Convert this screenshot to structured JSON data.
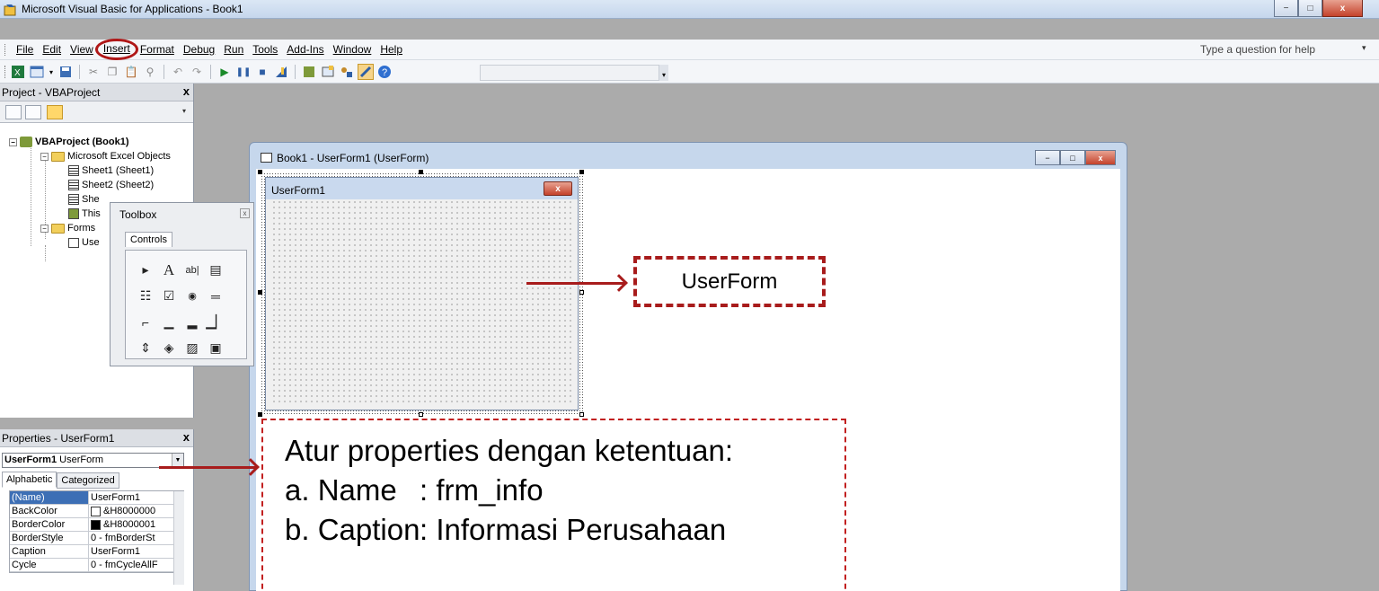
{
  "window": {
    "title": "Microsoft Visual Basic for Applications - Book1",
    "min_glyph": "−",
    "max_glyph": "□",
    "close_glyph": "x"
  },
  "menu": {
    "items": [
      "File",
      "Edit",
      "View",
      "Insert",
      "Format",
      "Debug",
      "Run",
      "Tools",
      "Add-Ins",
      "Window",
      "Help"
    ],
    "highlighted": "Insert",
    "help_placeholder": "Type a question for help"
  },
  "toolbar": {
    "icons": [
      "excel-icon",
      "insert-userform-icon",
      "dropdown-icon",
      "save-icon",
      "cut-icon",
      "copy-icon",
      "paste-icon",
      "find-icon",
      "undo-icon",
      "redo-icon",
      "run-icon",
      "break-icon",
      "reset-icon",
      "design-mode-icon",
      "project-explorer-icon",
      "properties-icon",
      "object-browser-icon",
      "toolbox-icon",
      "help-icon"
    ]
  },
  "project": {
    "title": "Project - VBAProject",
    "close": "x",
    "tree": {
      "root": "VBAProject (Book1)",
      "excel_folder": "Microsoft Excel Objects",
      "sheet1": "Sheet1 (Sheet1)",
      "sheet2": "Sheet2 (Sheet2)",
      "sheet3": "She",
      "thisworkbook": "This",
      "forms_folder": "Forms",
      "userform": "Use"
    }
  },
  "properties": {
    "title": "Properties - UserForm1",
    "close": "x",
    "object_name": "UserForm1",
    "object_type": "UserForm",
    "tabs": [
      "Alphabetic",
      "Categorized"
    ],
    "rows": [
      {
        "name": "(Name)",
        "value": "UserForm1",
        "swatch": ""
      },
      {
        "name": "BackColor",
        "value": "&H8000000",
        "swatch": "#ffffff"
      },
      {
        "name": "BorderColor",
        "value": "&H8000001",
        "swatch": "#000000"
      },
      {
        "name": "BorderStyle",
        "value": "0 - fmBorderSt",
        "swatch": ""
      },
      {
        "name": "Caption",
        "value": "UserForm1",
        "swatch": ""
      },
      {
        "name": "Cycle",
        "value": "0 - fmCycleAllF",
        "swatch": ""
      }
    ]
  },
  "form_window": {
    "title": "Book1 - UserForm1 (UserForm)"
  },
  "userform": {
    "caption": "UserForm1",
    "close_glyph": "x"
  },
  "toolbox": {
    "title": "Toolbox",
    "close": "x",
    "tab": "Controls",
    "controls": [
      "▸",
      "A",
      "ab|",
      "▤",
      "☷",
      "☑",
      "◉",
      "═",
      "⌐",
      "▁",
      "▂",
      "▁▏",
      "⇕",
      "◈",
      "▨",
      "▣"
    ]
  },
  "annotations": {
    "userform_label": "UserForm",
    "props_heading": "Atur properties dengan ketentuan:",
    "items": [
      {
        "label": "a. Name",
        "value": ": frm_info"
      },
      {
        "label": "b. Caption",
        "value": ": Informasi Perusahaan"
      }
    ]
  }
}
